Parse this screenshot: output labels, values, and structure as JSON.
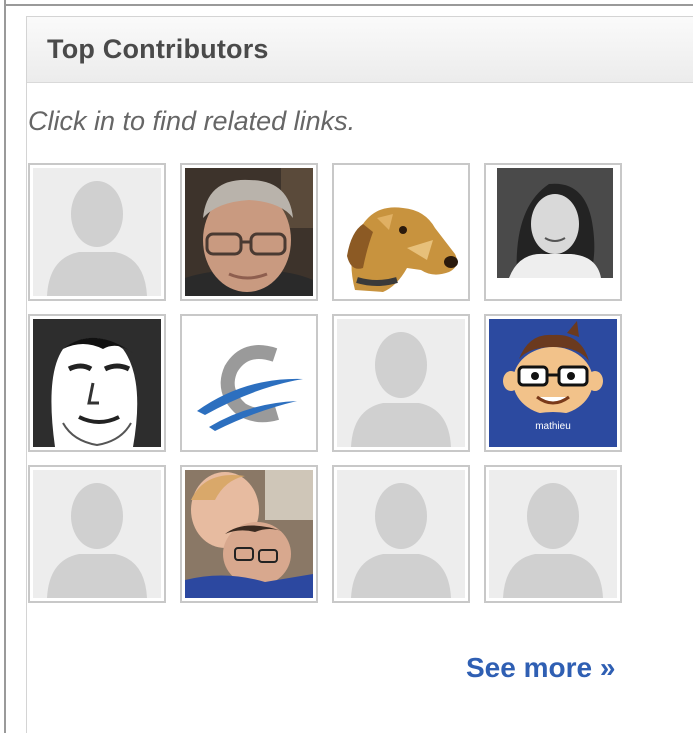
{
  "widget": {
    "title": "Top Contributors",
    "hint": "Click in to find related links.",
    "see_more_label": "See more »",
    "link_color": "#2f5fb3"
  },
  "contributors": [
    {
      "avatar": "default-avatar-icon"
    },
    {
      "avatar": "man-with-glasses-photo"
    },
    {
      "avatar": "dog-illustration"
    },
    {
      "avatar": "woman-bw-photo"
    },
    {
      "avatar": "sketched-face-portrait"
    },
    {
      "avatar": "blue-swoosh-logo"
    },
    {
      "avatar": "default-avatar-icon"
    },
    {
      "avatar": "cartoon-avatar",
      "caption": "mathieu"
    },
    {
      "avatar": "default-avatar-icon"
    },
    {
      "avatar": "couple-photo"
    },
    {
      "avatar": "default-avatar-icon"
    },
    {
      "avatar": "default-avatar-icon"
    }
  ]
}
